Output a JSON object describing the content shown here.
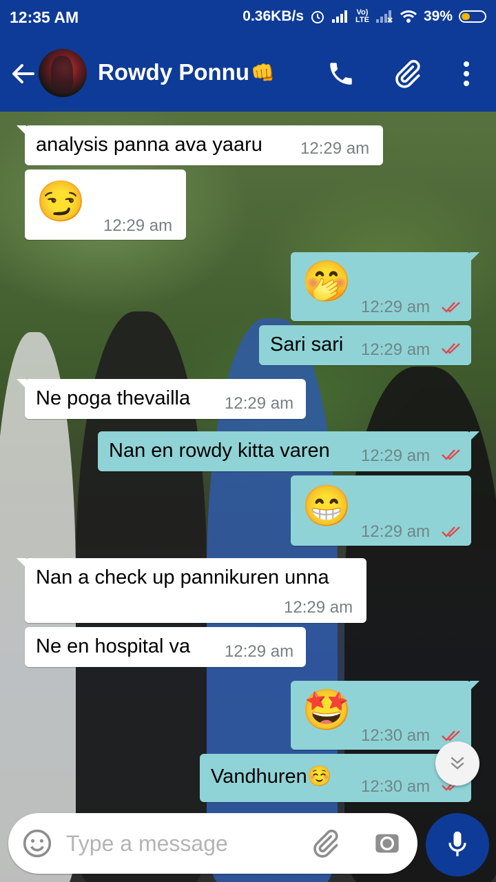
{
  "status_bar": {
    "time": "12:35 AM",
    "network_speed": "0.36KB/s",
    "lte_label": "Vo) LTE",
    "battery_percent": "39%",
    "battery_level": 0.39
  },
  "header": {
    "contact_name": "Rowdy Ponnu",
    "name_emoji": "👊"
  },
  "messages": [
    {
      "direction": "in",
      "text": "analysis panna ava yaaru",
      "time": "12:29 am"
    },
    {
      "direction": "in",
      "emoji": "😏",
      "time": "12:29 am"
    },
    {
      "direction": "out",
      "emoji": "🤭",
      "time": "12:29 am",
      "status": "read"
    },
    {
      "direction": "out",
      "text": "Sari sari",
      "time": "12:29 am",
      "status": "read"
    },
    {
      "direction": "in",
      "text": "Ne poga thevailla",
      "time": "12:29 am"
    },
    {
      "direction": "out",
      "text": "Nan en rowdy kitta varen",
      "time": "12:29 am",
      "status": "read"
    },
    {
      "direction": "out",
      "emoji": "😁",
      "time": "12:29 am",
      "status": "read"
    },
    {
      "direction": "in",
      "text": "Nan a check up pannikuren unna",
      "time": "12:29 am"
    },
    {
      "direction": "in",
      "text": "Ne en hospital va",
      "time": "12:29 am"
    },
    {
      "direction": "out",
      "emoji": "🤩",
      "time": "12:30 am",
      "status": "read"
    },
    {
      "direction": "out",
      "text": "Vandhuren",
      "text_emoji": "☺️",
      "time": "12:30 am",
      "status": "read"
    }
  ],
  "composer": {
    "placeholder": "Type a message"
  },
  "colors": {
    "app_bar": "#0d3b97",
    "outgoing_bubble": "#8fd3d6",
    "incoming_bubble": "#ffffff",
    "read_tick": "#e0484d"
  }
}
